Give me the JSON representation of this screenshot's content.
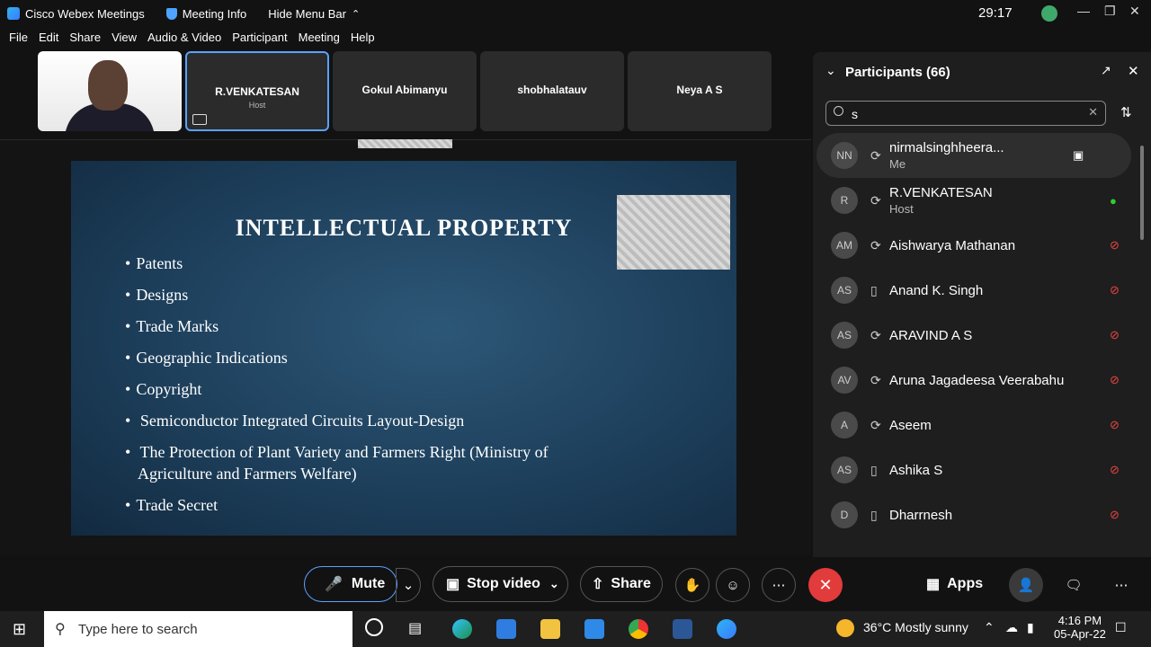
{
  "window": {
    "app_title": "Cisco Webex Meetings",
    "meeting_info": "Meeting Info",
    "hide_menu": "Hide Menu Bar",
    "timer": "29:17"
  },
  "menu": [
    "File",
    "Edit",
    "Share",
    "View",
    "Audio & Video",
    "Participant",
    "Meeting",
    "Help"
  ],
  "thumbnails": [
    {
      "name": "R.VENKATESAN",
      "sub": "Host"
    },
    {
      "name": "Gokul Abimanyu",
      "sub": ""
    },
    {
      "name": "shobhalatauv",
      "sub": ""
    },
    {
      "name": "Neya A S",
      "sub": ""
    }
  ],
  "slide": {
    "title": "INTELLECTUAL PROPERTY",
    "bullets": [
      "Patents",
      "Designs",
      "Trade Marks",
      "Geographic Indications",
      "Copyright",
      " Semiconductor Integrated Circuits Layout-Design",
      " The Protection of Plant Variety and Farmers Right (Ministry of",
      "Agriculture and Farmers Welfare)",
      "Trade Secret"
    ]
  },
  "participants": {
    "title": "Participants (66)",
    "search_value": "s",
    "list": [
      {
        "initials": "NN",
        "name": "nirmalsinghheera...",
        "role": "Me",
        "device": "sync",
        "mic": "video"
      },
      {
        "initials": "R",
        "name": "R.VENKATESAN",
        "role": "Host",
        "device": "sync",
        "mic": "on"
      },
      {
        "initials": "AM",
        "name": "Aishwarya Mathanan",
        "role": "",
        "device": "sync",
        "mic": "muted"
      },
      {
        "initials": "AS",
        "name": "Anand K. Singh",
        "role": "",
        "device": "phone",
        "mic": "muted"
      },
      {
        "initials": "AS",
        "name": "ARAVIND A S",
        "role": "",
        "device": "sync",
        "mic": "muted"
      },
      {
        "initials": "AV",
        "name": "Aruna Jagadeesa Veerabahu",
        "role": "",
        "device": "sync",
        "mic": "muted"
      },
      {
        "initials": "A",
        "name": "Aseem",
        "role": "",
        "device": "sync",
        "mic": "muted"
      },
      {
        "initials": "AS",
        "name": "Ashika S",
        "role": "",
        "device": "phone",
        "mic": "muted"
      },
      {
        "initials": "D",
        "name": "Dharrnesh",
        "role": "",
        "device": "phone",
        "mic": "muted"
      }
    ]
  },
  "controls": {
    "mute": "Mute",
    "stop_video": "Stop video",
    "share": "Share",
    "apps": "Apps"
  },
  "taskbar": {
    "search_placeholder": "Type here to search",
    "weather": "36°C  Mostly sunny",
    "time": "4:16 PM",
    "date": "05-Apr-22"
  }
}
